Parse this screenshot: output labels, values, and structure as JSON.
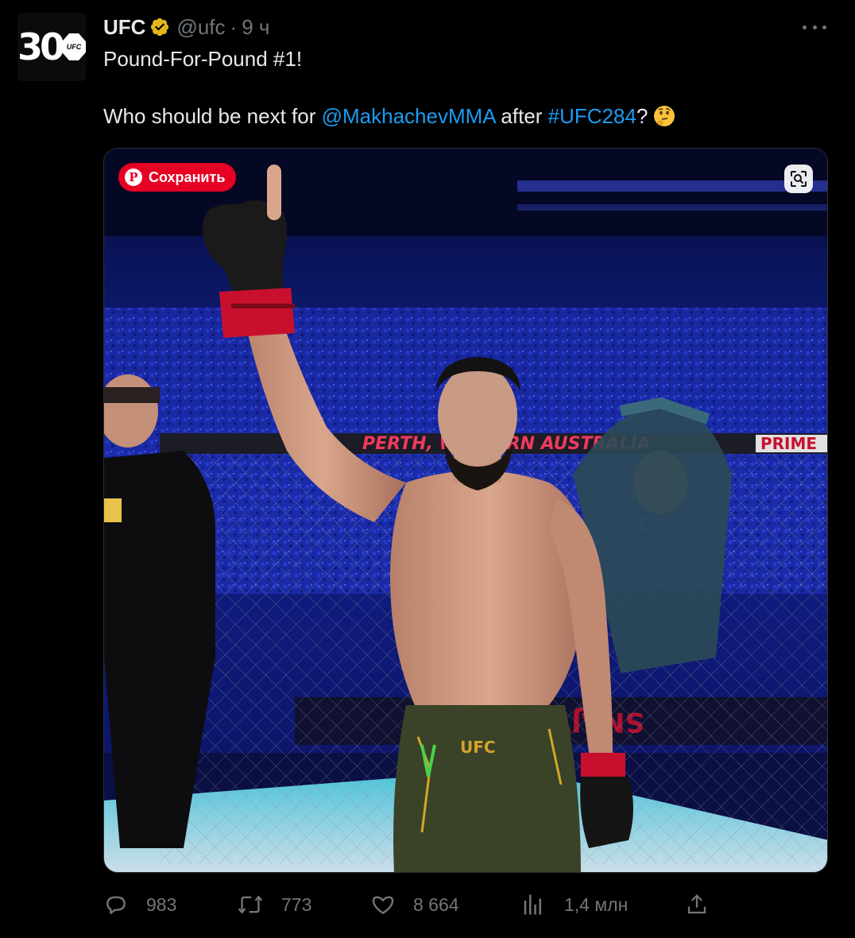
{
  "tweet": {
    "author_name": "UFC",
    "handle": "@ufc",
    "separator": "·",
    "time": "9 ч",
    "avatar_number": "30",
    "avatar_badge": "UFC",
    "line1": "Pound-For-Pound #1!",
    "line2_prefix": "Who should be next for ",
    "mention": "@MakhachevMMA",
    "line2_mid": " after ",
    "hashtag": "#UFC284",
    "line2_suffix": "?",
    "emoji": "thinking-face"
  },
  "media": {
    "pinterest_label": "Сохранить",
    "pinterest_logo": "P",
    "banner_left": "PERTH, WESTERN AUSTRALIA",
    "banner_right": "PRIME",
    "shorts_brand": "UFC",
    "colors": {
      "crowd_blue": "#1b2fb8",
      "rail_red": "#c8102e",
      "mat_cyan": "#4fd6ea"
    }
  },
  "actions": {
    "replies": "983",
    "retweets": "773",
    "likes": "8 664",
    "views": "1,4 млн"
  },
  "colors": {
    "background": "#000000",
    "text": "#e7e9ea",
    "secondary": "#71767b",
    "link": "#1d9bf0",
    "verified": "#e2b719",
    "pinterest": "#e60023"
  }
}
